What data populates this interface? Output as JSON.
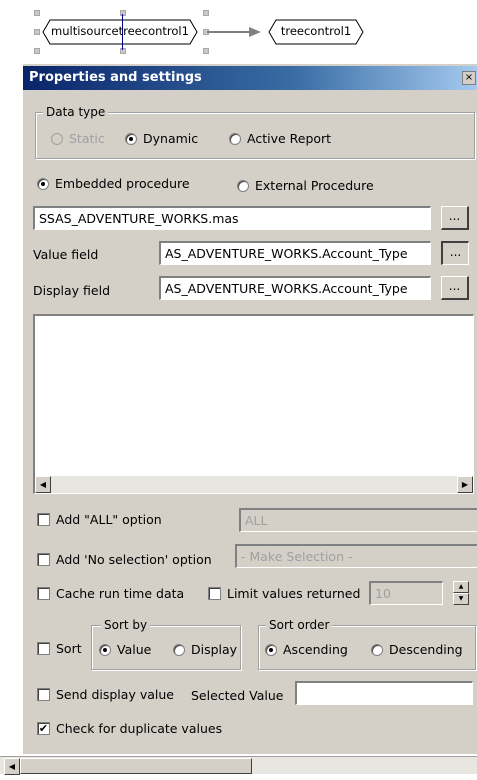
{
  "flow": {
    "source_node": "multisourcetreecontrol1",
    "target_node": "treecontrol1"
  },
  "panel": {
    "title": "Properties and settings",
    "close_glyph": "×"
  },
  "data_type": {
    "legend": "Data type",
    "options": [
      "Static",
      "Dynamic",
      "Active Report"
    ],
    "selected": "Dynamic"
  },
  "procedure": {
    "options": [
      "Embedded procedure",
      "External Procedure"
    ],
    "selected": "Embedded procedure",
    "file_value": "SSAS_ADVENTURE_WORKS.mas"
  },
  "fields": {
    "value_label": "Value field",
    "value_value": "AS_ADVENTURE_WORKS.Account_Type",
    "display_label": "Display field",
    "display_value": "AS_ADVENTURE_WORKS.Account_Type",
    "browse_label": "..."
  },
  "options": {
    "add_all_label": "Add \"ALL\" option",
    "add_all_value": "ALL",
    "add_no_selection_label": "Add 'No selection' option",
    "no_selection_value": "- Make Selection -",
    "cache_label": "Cache run time data",
    "limit_label": "Limit values returned",
    "limit_value": "10",
    "sort_label": "Sort",
    "sort_by_legend": "Sort by",
    "sort_by_options": [
      "Value",
      "Display"
    ],
    "sort_by_selected": "Value",
    "sort_order_legend": "Sort order",
    "sort_order_options": [
      "Ascending",
      "Descending"
    ],
    "sort_order_selected": "Ascending",
    "send_display_label": "Send display value",
    "selected_value_label": "Selected Value",
    "selected_value": "",
    "duplicates_label": "Check for duplicate values",
    "duplicates_checked": "✔"
  },
  "scroll": {
    "left_arrow": "◀",
    "right_arrow": "▶",
    "up_arrow": "▲",
    "down_arrow": "▼"
  }
}
